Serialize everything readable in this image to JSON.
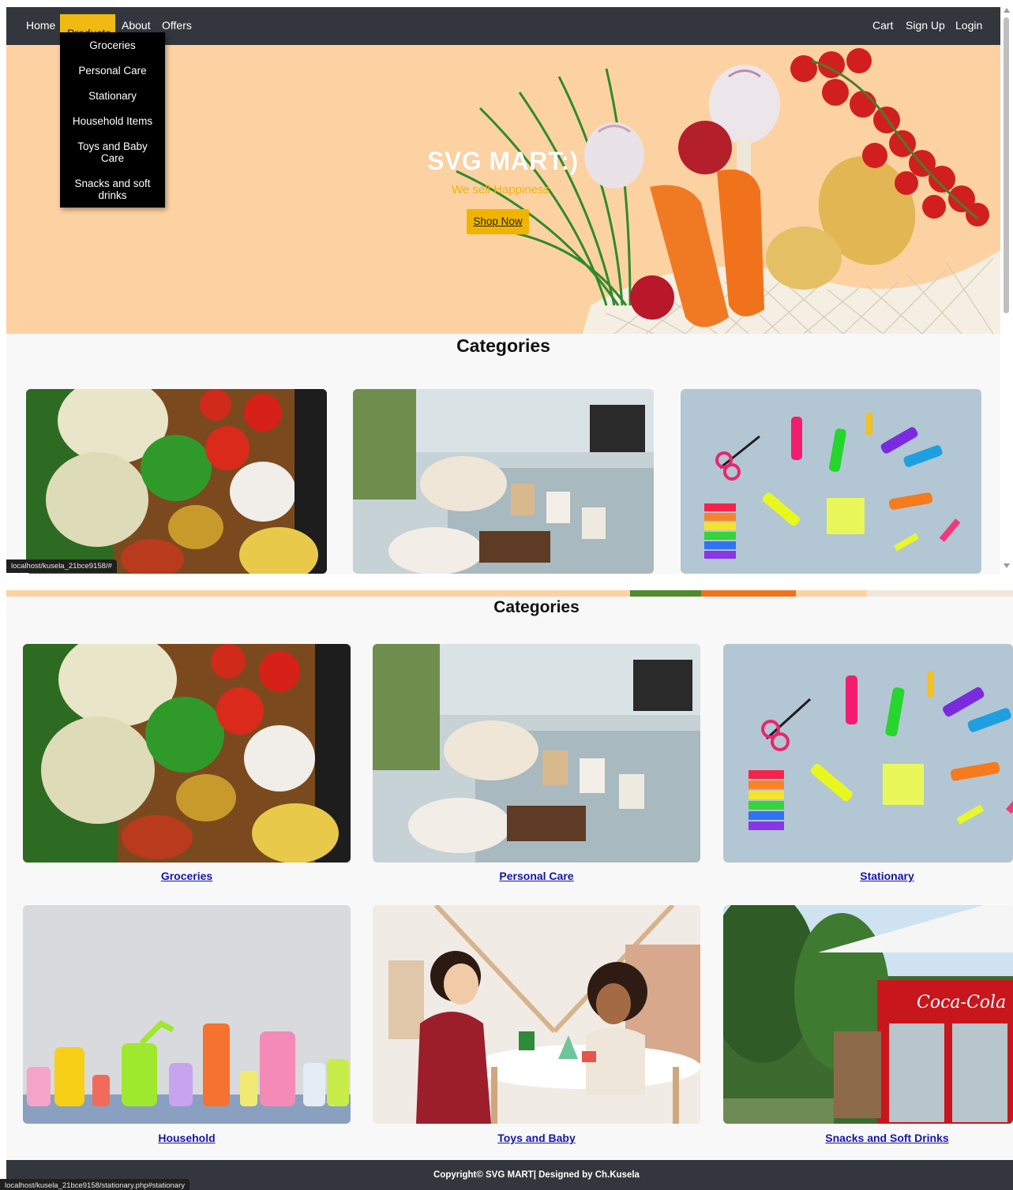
{
  "nav": {
    "home": "Home",
    "products": "Products",
    "about": "About",
    "offers": "Offers",
    "cart": "Cart",
    "sign_up": "Sign Up",
    "login": "Login",
    "active_color": "#f0ba12",
    "bar_color": "#33373d"
  },
  "products_menu": {
    "items": [
      "Groceries",
      "Personal Care",
      "Stationary",
      "Household Items",
      "Toys and Baby Care",
      "Snacks and soft drinks"
    ]
  },
  "hero": {
    "title": "SVG MART:)",
    "subtitle": "We sell Happiness",
    "button": "Shop Now",
    "background": "#fdd2a3"
  },
  "categories": {
    "heading": "Categories",
    "items": [
      {
        "label": "Groceries",
        "image": "vegetables-spices-photo"
      },
      {
        "label": "Personal Care",
        "image": "bath-products-shelf-photo"
      },
      {
        "label": "Stationary",
        "image": "highlighters-scissors-photo"
      },
      {
        "label": "Household",
        "image": "colorful-bottles-photo"
      },
      {
        "label": "Toys and Baby",
        "image": "children-playing-photo"
      },
      {
        "label": "Snacks and Soft Drinks",
        "image": "coca-cola-kiosk-photo"
      }
    ]
  },
  "footer": {
    "text": "Copyright© SVG MART| Designed by Ch.Kusela"
  },
  "status_bar": {
    "url_top": "localhost/kusela_21bce9158/#",
    "url_bottom": "localhost/kusela_21bce9158/stationary.php#stationary"
  }
}
